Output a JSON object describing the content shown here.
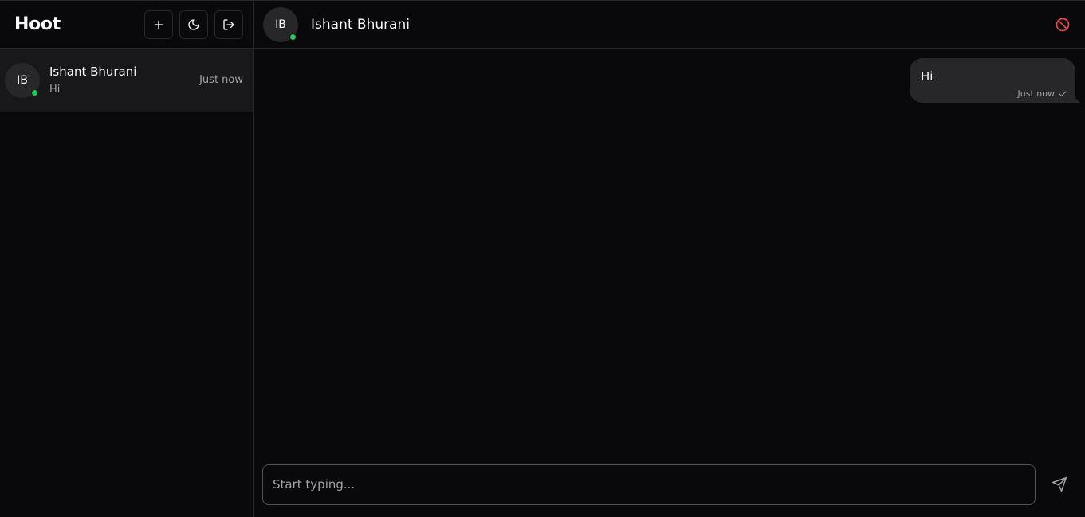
{
  "app": {
    "title": "Hoot"
  },
  "sidebar": {
    "actions": [
      {
        "name": "new-chat",
        "icon": "plus-icon"
      },
      {
        "name": "theme-toggle",
        "icon": "moon-icon"
      },
      {
        "name": "logout",
        "icon": "logout-icon"
      }
    ],
    "chats": [
      {
        "initials": "IB",
        "name": "Ishant Bhurani",
        "preview": "Hi",
        "time": "Just now",
        "online": true
      }
    ]
  },
  "conversation": {
    "contact": {
      "initials": "IB",
      "name": "Ishant Bhurani",
      "online": true
    },
    "block_icon": "block-icon",
    "messages": [
      {
        "text": "Hi",
        "time": "Just now",
        "status_icon": "check-icon",
        "outgoing": true
      }
    ]
  },
  "composer": {
    "placeholder": "Start typing...",
    "value": "",
    "send_icon": "send-icon"
  },
  "colors": {
    "background": "#09090b",
    "surface": "#18181b",
    "bubble": "#27272a",
    "border": "#27272a",
    "online": "#22c55e",
    "danger": "#ef4444",
    "muted_text": "#a1a1aa"
  }
}
